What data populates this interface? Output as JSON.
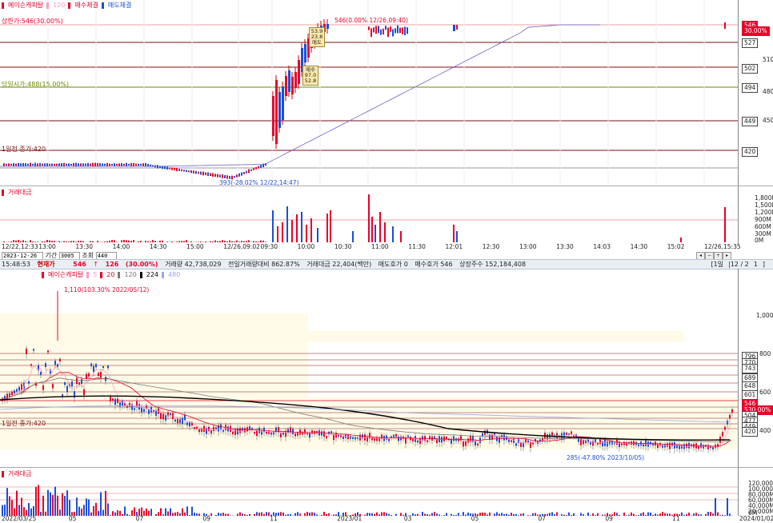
{
  "top": {
    "legend": [
      {
        "label": "메이슨캐피탈",
        "color": "#e8002a"
      },
      {
        "label": "120",
        "color": "#ff9ac6"
      },
      {
        "label": "매수체결",
        "color": "#e8002a"
      },
      {
        "label": "매도체결",
        "color": "#1a4fd6"
      }
    ],
    "levels": {
      "upper": "상한가:546(30.00%)",
      "lower": "당일시가:488(15.00%)",
      "prev_close": "1일전 종가:420"
    },
    "high_ann": "546(0.00% 12/26,09:40)",
    "low_ann": "393(-28.02% 12/22,14:47)",
    "tooltip1": [
      "53.9",
      "23.8",
      "매도"
    ],
    "tooltip2": [
      "매수",
      "97.0",
      "52.8"
    ],
    "axis": [
      "546",
      "527",
      "510",
      "502",
      "494",
      "480",
      "449",
      "450",
      "420"
    ],
    "axis_tags": {
      "last": "546",
      "last_pct": "30.00%"
    },
    "xticks": [
      "12/22,12:33",
      "13:00",
      "13:30",
      "14:00",
      "14:30",
      "15:00",
      "12/26,09:02",
      "09:30",
      "10:00",
      "10:30",
      "11:00",
      "11:30",
      "12:01",
      "12:30",
      "13:00",
      "13:30",
      "14:03",
      "14:30",
      "15:02",
      "12/26,15:35"
    ],
    "volume_title": "거래대금",
    "vol_axis": [
      "1,800M",
      "1,500M",
      "1,200M",
      "900M",
      "600M",
      "300M",
      "0M"
    ]
  },
  "status": {
    "time": "15:48:53",
    "label_now": "현재가",
    "price": "546",
    "arrow": "↑",
    "change": "126",
    "pct": "(30.00%)",
    "volume": "거래량 42,738,029",
    "ratio": "전일거래량대비 862.87%",
    "amount": "거래대금 22,404(백만)",
    "ask": "매도호가 0",
    "bid": "매수호가 546",
    "shares": "상장주수 152,184,408",
    "period": "1일",
    "page": "12 / 2",
    "page_total": "1"
  },
  "controls": {
    "date": "2023-12-26",
    "period_label": "기간",
    "period_value": "3005",
    "view_label": "조회",
    "view_value": "440"
  },
  "bottom": {
    "legend": [
      {
        "label": "메이슨캐피탈",
        "color": "#e8002a"
      },
      {
        "label": "5",
        "color": "#ff9ac6"
      },
      {
        "label": "20",
        "color": "#e8002a"
      },
      {
        "label": "120",
        "color": "#777777"
      },
      {
        "label": "224",
        "color": "#000000"
      },
      {
        "label": "480",
        "color": "#9aa8e8"
      }
    ],
    "high_ann": "1,110(103.30% 2022/05/12)",
    "low_ann": "285(-47.80% 2023/10/05)",
    "prev_close": "1일전 종가:420",
    "axis": [
      "1,000",
      "800",
      "600",
      "400"
    ],
    "tags": [
      "796",
      "770",
      "743",
      "689",
      "648",
      "601",
      "546",
      "530.00%",
      "504",
      "477",
      "449",
      "420"
    ],
    "xticks": [
      "2022/03/25",
      "05",
      "07",
      "09",
      "11",
      "2023/01",
      "03",
      "05",
      "07",
      "09",
      "11",
      "2024/01/02"
    ],
    "volume_title": "거래대금",
    "vol_axis": [
      "120,000M",
      "100,000M",
      "80,000M",
      "60,000M",
      "40,000M",
      "20,000M",
      "0M"
    ]
  }
}
